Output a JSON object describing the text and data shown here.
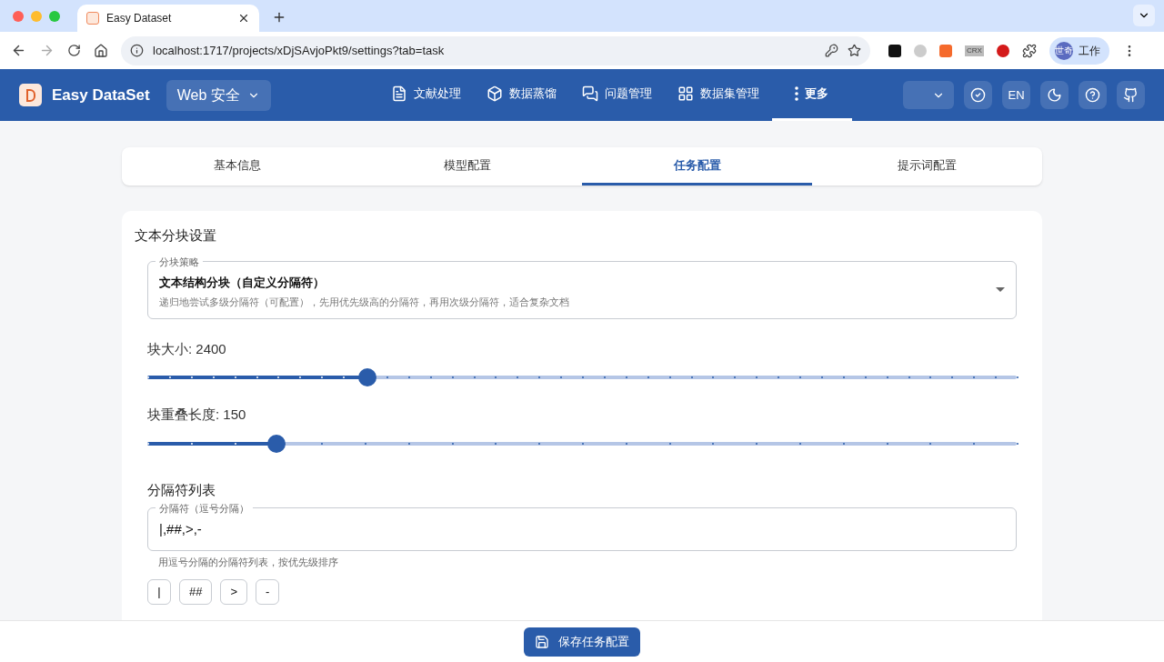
{
  "browser": {
    "tab_title": "Easy Dataset",
    "url": "localhost:1717/projects/xDjSAvjoPkt9/settings?tab=task",
    "extension_label": "CRX",
    "profile_avatar": "世奇",
    "profile_label": "工作"
  },
  "header": {
    "logo_text": "Easy DataSet",
    "project": "Web 安全",
    "nav": [
      {
        "label": "文献处理",
        "kind": "file",
        "selected": false
      },
      {
        "label": "数据蒸馏",
        "kind": "cube",
        "selected": false
      },
      {
        "label": "问题管理",
        "kind": "chat",
        "selected": false
      },
      {
        "label": "数据集管理",
        "kind": "grid",
        "selected": false
      },
      {
        "label": "更多",
        "kind": "more",
        "selected": true
      }
    ],
    "language": "EN"
  },
  "settings_tabs": [
    {
      "label": "基本信息",
      "selected": false
    },
    {
      "label": "模型配置",
      "selected": false
    },
    {
      "label": "任务配置",
      "selected": true
    },
    {
      "label": "提示词配置",
      "selected": false
    }
  ],
  "chunking": {
    "title": "文本分块设置",
    "strategy": {
      "label": "分块策略",
      "value": "文本结构分块（自定义分隔符）",
      "description": "递归地尝试多级分隔符（可配置），先用优先级高的分隔符，再用次级分隔符，适合复杂文档"
    },
    "sliders": [
      {
        "label": "块大小: 2400",
        "level": 0.253
      },
      {
        "label": "块重叠长度: 150",
        "level": 0.149
      }
    ],
    "separators": {
      "title": "分隔符列表",
      "field_label": "分隔符（逗号分隔）",
      "value": "|,##,>,-",
      "helper": "用逗号分隔的分隔符列表，按优先级排序",
      "chips": [
        "|",
        "##",
        ">",
        "-"
      ]
    }
  },
  "save_button": "保存任务配置"
}
